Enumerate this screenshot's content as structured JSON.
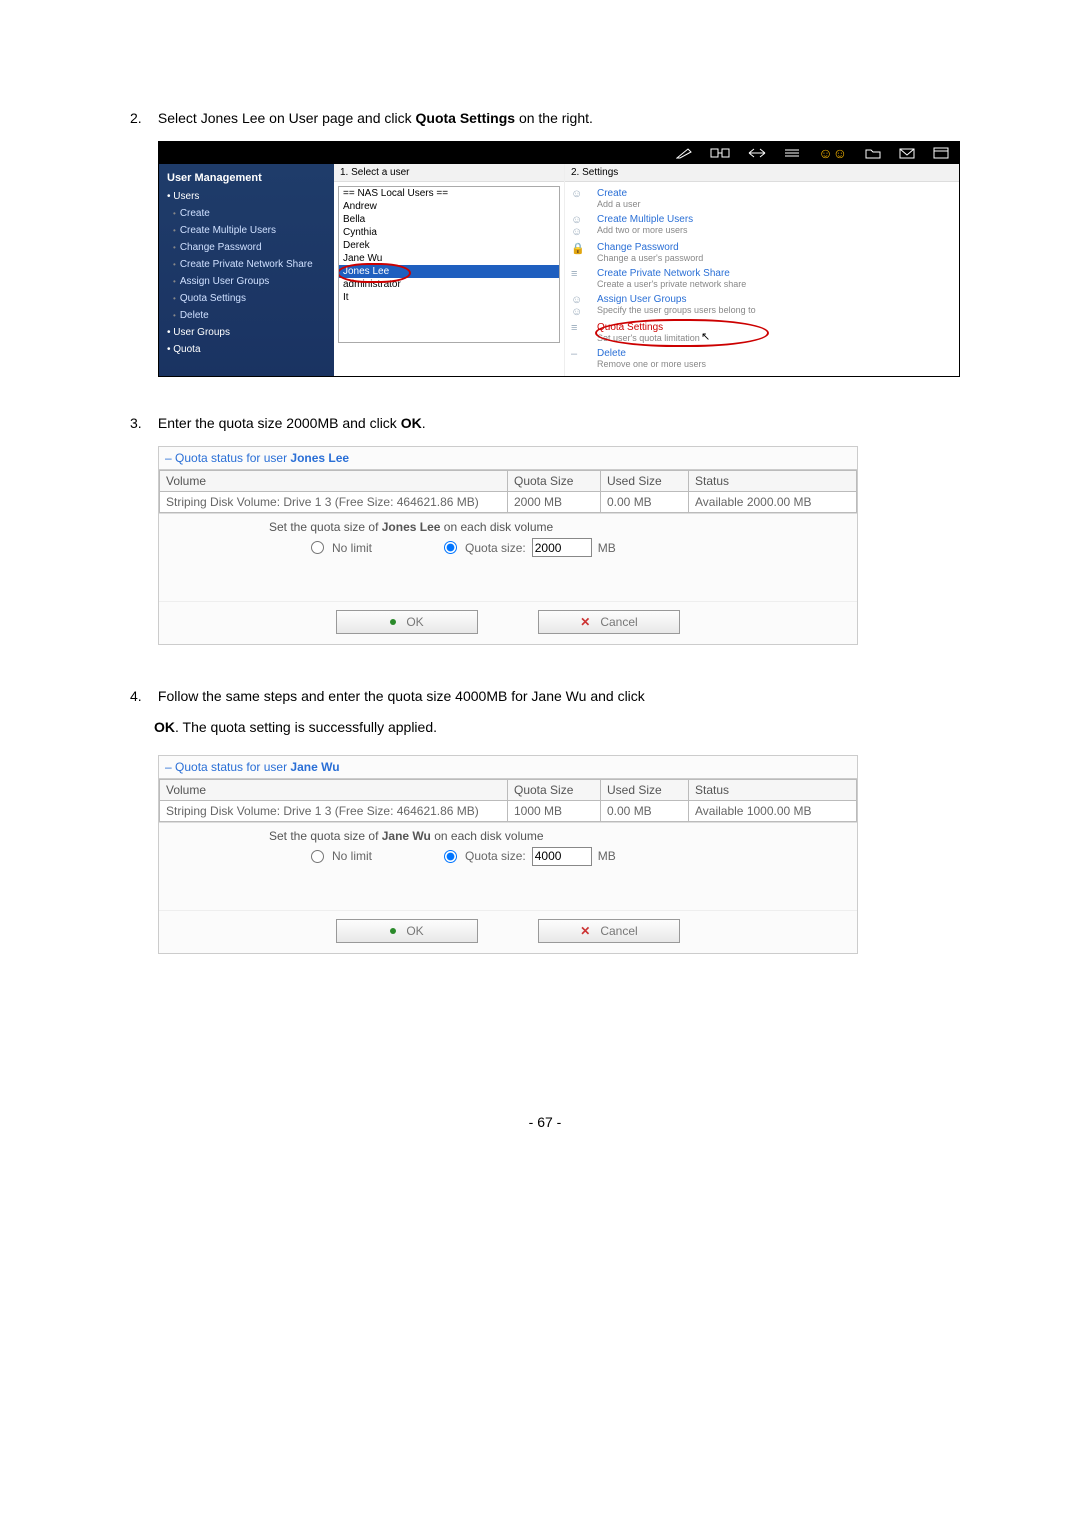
{
  "step2": {
    "text_full": "2.  Select Jones Lee on User page and click Quota Settings on the right.",
    "num": "2.",
    "before": "Select Jones Lee on User page and click ",
    "bold": "Quota Settings",
    "after": " on the right."
  },
  "shot1": {
    "sidebar": {
      "header": "User Management",
      "users": "Users",
      "items": [
        "Create",
        "Create Multiple Users",
        "Change Password",
        "Create Private Network Share",
        "Assign User Groups",
        "Quota Settings",
        "Delete"
      ],
      "usergroups": "User Groups",
      "quota": "Quota"
    },
    "mid_label": "1. Select a user",
    "userlist": [
      "== NAS Local Users ==",
      "Andrew",
      "Bella",
      "Cynthia",
      "Derek",
      "Jane Wu",
      "Jones Lee",
      "administrator",
      "It"
    ],
    "right_label": "2. Settings",
    "actions": [
      {
        "t": "Create",
        "s": "Add a user"
      },
      {
        "t": "Create Multiple Users",
        "s": "Add two or more users"
      },
      {
        "t": "Change Password",
        "s": "Change a user's password"
      },
      {
        "t": "Create Private Network Share",
        "s": "Create a user's private network share"
      },
      {
        "t": "Assign User Groups",
        "s": "Specify the user groups users belong to"
      },
      {
        "t": "Quota Settings",
        "s": "Set user's quota limitation"
      },
      {
        "t": "Delete",
        "s": "Remove one or more users"
      }
    ]
  },
  "step3": {
    "num": "3.",
    "before": "Enter the quota size 2000MB and click ",
    "bold": "OK",
    "after": "."
  },
  "panel1": {
    "title_prefix": "– Quota status for user ",
    "title_user": "Jones Lee",
    "headers": [
      "Volume",
      "Quota Size",
      "Used Size",
      "Status"
    ],
    "row": [
      "Striping Disk Volume: Drive 1 3 (Free Size: 464621.86 MB)",
      "2000 MB",
      "0.00 MB",
      "Available 2000.00 MB"
    ],
    "set_label_prefix": "Set the quota size of ",
    "set_label_user": "Jones Lee",
    "set_label_suffix": " on each disk volume",
    "nolimit": "No limit",
    "qsize": "Quota size:",
    "qval": "2000",
    "mb": "MB",
    "ok": "OK",
    "cancel": "Cancel"
  },
  "step4": {
    "num": "4.",
    "line1_before": "Follow the same steps and enter the quota size 4000MB for Jane Wu and click ",
    "line2_bold": "OK",
    "line2_after": ".  The quota setting is successfully applied."
  },
  "panel2": {
    "title_prefix": "– Quota status for user ",
    "title_user": "Jane Wu",
    "headers": [
      "Volume",
      "Quota Size",
      "Used Size",
      "Status"
    ],
    "row": [
      "Striping Disk Volume: Drive 1 3 (Free Size: 464621.86 MB)",
      "1000 MB",
      "0.00 MB",
      "Available 1000.00 MB"
    ],
    "set_label_prefix": "Set the quota size of ",
    "set_label_user": "Jane Wu",
    "set_label_suffix": " on each disk volume",
    "nolimit": "No limit",
    "qsize": "Quota size:",
    "qval": "4000",
    "mb": "MB",
    "ok": "OK",
    "cancel": "Cancel"
  },
  "footer": "- 67 -"
}
